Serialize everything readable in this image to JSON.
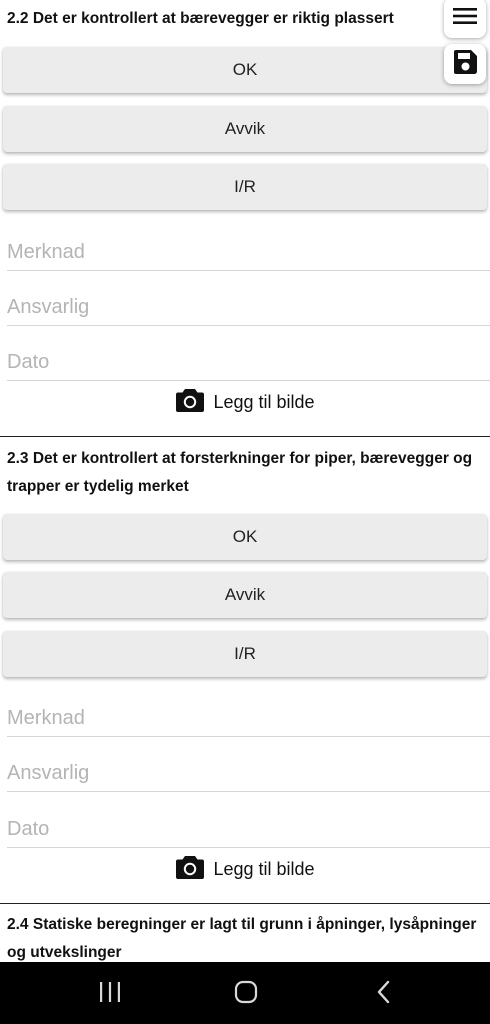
{
  "sections": [
    {
      "title": "2.2 Det er kontrollert at bærevegger er riktig plassert",
      "buttons": [
        "OK",
        "Avvik",
        "I/R"
      ],
      "fields": {
        "remark_placeholder": "Merknad",
        "responsible_placeholder": "Ansvarlig",
        "date_placeholder": "Dato"
      },
      "add_photo_label": "Legg til bilde"
    },
    {
      "title_line1": "2.3 Det er kontrollert at forsterkninger for piper, bærevegger og",
      "title_line2": "trapper er tydelig merket",
      "buttons": [
        "OK",
        "Avvik",
        "I/R"
      ],
      "fields": {
        "remark_placeholder": "Merknad",
        "responsible_placeholder": "Ansvarlig",
        "date_placeholder": "Dato"
      },
      "add_photo_label": "Legg til bilde"
    },
    {
      "title_line1": "2.4 Statiske beregninger er lagt til grunn i åpninger, lysåpninger",
      "title_line2": "og utvekslinger"
    }
  ],
  "toolbar": {
    "menu_icon": "hamburger-menu-icon",
    "save_icon": "floppy-disk-save-icon"
  },
  "system_nav": {
    "recent_icon": "recent-apps-icon",
    "home_icon": "home-icon",
    "back_icon": "back-icon"
  }
}
